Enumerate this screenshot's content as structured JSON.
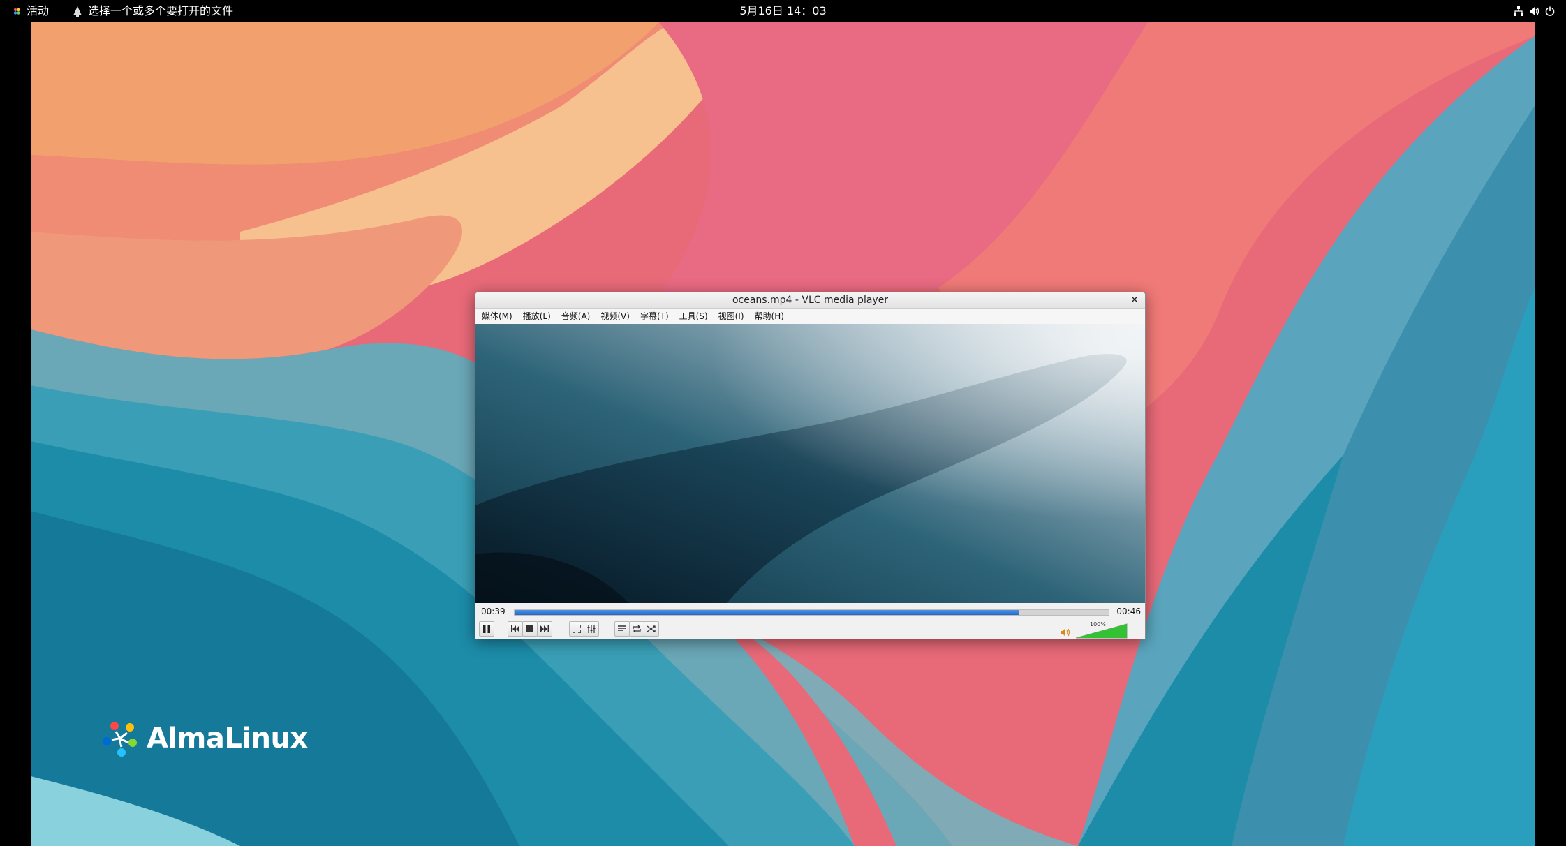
{
  "topbar": {
    "activities": "活动",
    "app_name": "选择一个或多个要打开的文件",
    "clock": "5月16日  14：03",
    "tray_icons": [
      "network-icon",
      "volume-icon",
      "power-icon"
    ]
  },
  "desktop": {
    "logo_text": "AlmaLinux"
  },
  "vlc": {
    "title": "oceans.mp4 - VLC media player",
    "close": "✕",
    "menus": [
      "媒体(M)",
      "播放(L)",
      "音频(A)",
      "视频(V)",
      "字幕(T)",
      "工具(S)",
      "视图(I)",
      "帮助(H)"
    ],
    "time_elapsed": "00:39",
    "time_total": "00:46",
    "progress": 0.85,
    "volume_label": "100%",
    "volume": 1.0,
    "controls": [
      "pause",
      "previous",
      "stop",
      "next",
      "fullscreen",
      "extended-settings",
      "playlist",
      "loop",
      "shuffle"
    ]
  },
  "colors": {
    "accent": "#2a6fd1",
    "volume_fill": "#33c233",
    "topbar_bg": "#000000"
  }
}
